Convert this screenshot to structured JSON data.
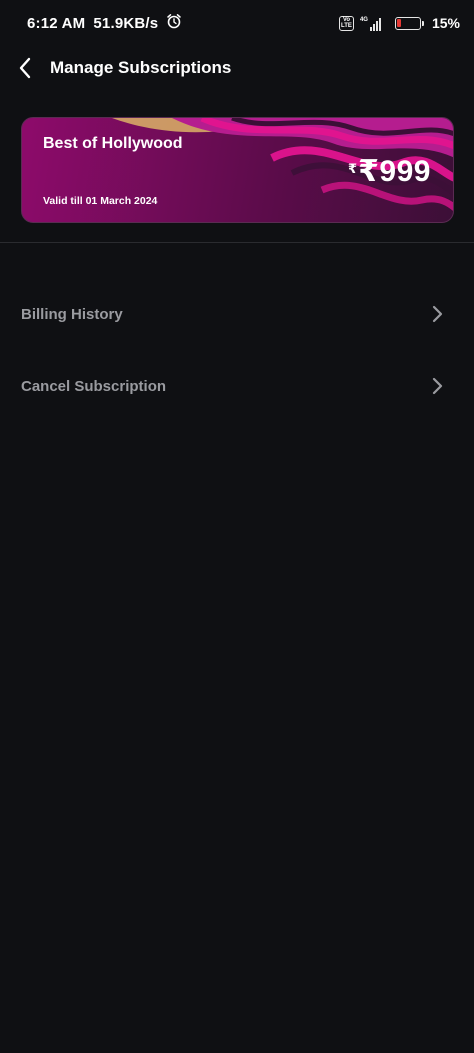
{
  "status_bar": {
    "time": "6:12 AM",
    "speed": "51.9KB/s",
    "volte_line1": "Vo",
    "volte_line2": "LTE",
    "network": "4G",
    "battery_percent": "15%",
    "battery_level": 0.15,
    "battery_color": "#e53935"
  },
  "header": {
    "title": "Manage Subscriptions"
  },
  "subscription_card": {
    "plan_name": "Best of Hollywood",
    "small_currency": "₹",
    "price": "₹999",
    "valid_text": "Valid till 01 March 2024"
  },
  "menu": {
    "items": [
      {
        "label": "Billing History"
      },
      {
        "label": "Cancel Subscription"
      }
    ]
  },
  "colors": {
    "background": "#0f1013",
    "card_primary": "#8e0b6b",
    "card_wave_pink": "#e0148f",
    "card_wave_gold": "#d6a866",
    "muted_text": "#9a9ba0"
  }
}
